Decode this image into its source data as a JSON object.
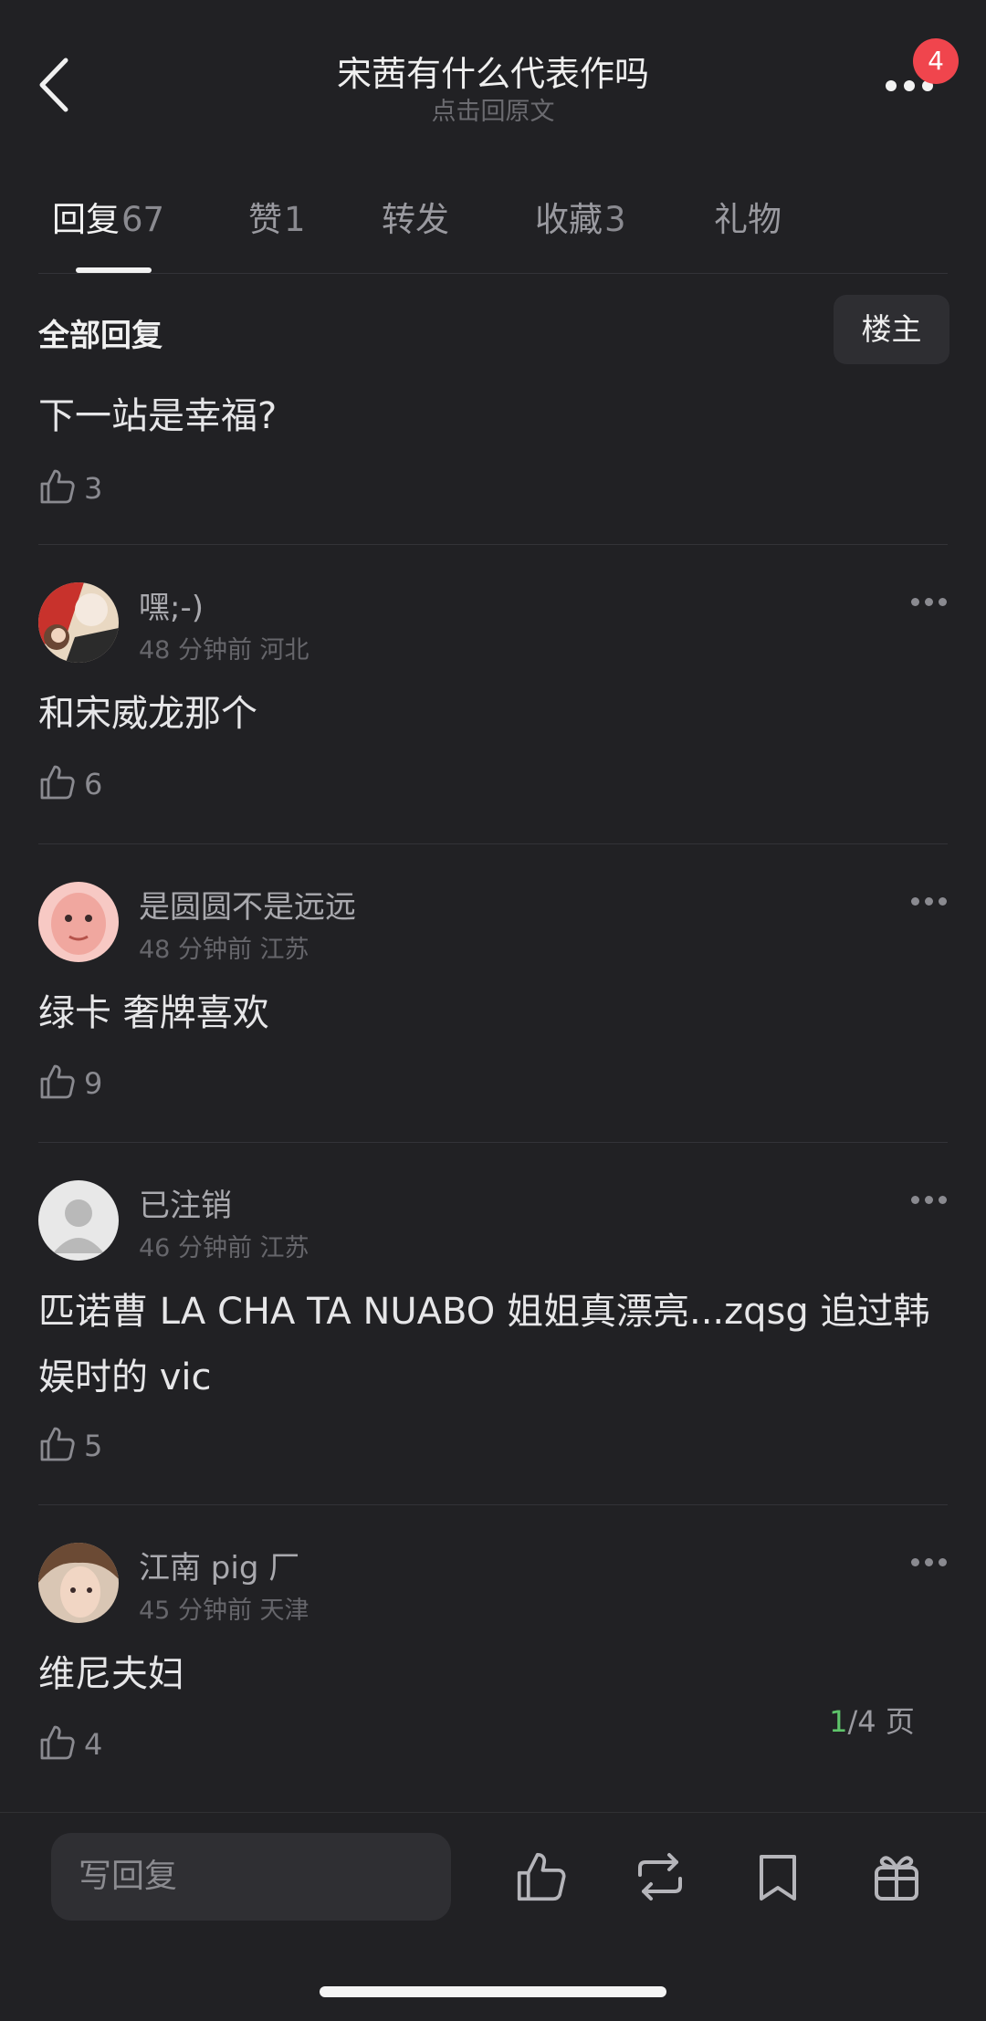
{
  "header": {
    "title": "宋茜有什么代表作吗",
    "subtitle": "点击回原文",
    "badge_count": "4"
  },
  "tabs": [
    {
      "label": "回复",
      "count": "67",
      "active": true
    },
    {
      "label": "赞",
      "count": "1"
    },
    {
      "label": "转发",
      "count": ""
    },
    {
      "label": "收藏",
      "count": "3"
    },
    {
      "label": "礼物",
      "count": ""
    }
  ],
  "section": {
    "title": "全部回复",
    "owner_filter": "楼主"
  },
  "comments": [
    {
      "username": "",
      "time": "",
      "location": "",
      "content": "下一站是幸福?",
      "likes": "3"
    },
    {
      "username": "嘿;-)",
      "time": "48 分钟前",
      "location": "河北",
      "content": "和宋威龙那个",
      "likes": "6"
    },
    {
      "username": "是圆圆不是远远",
      "time": "48 分钟前",
      "location": "江苏",
      "content": "绿卡  奢牌喜欢",
      "likes": "9"
    },
    {
      "username": "已注销",
      "time": "46 分钟前",
      "location": "江苏",
      "content": "匹诺曹 LA CHA TA NUABO 姐姐真漂亮...zqsg 追过韩娱时的 vic",
      "likes": "5"
    },
    {
      "username": "江南 pig 厂",
      "time": "45 分钟前",
      "location": "天津",
      "content": "维尼夫妇",
      "likes": "4"
    }
  ],
  "pager": {
    "current": "1",
    "total_text": "/4 页"
  },
  "bottom_bar": {
    "reply_placeholder": "写回复"
  },
  "colors": {
    "background": "#212124",
    "badge": "#f0454d",
    "pager_current": "#5ec46a"
  }
}
